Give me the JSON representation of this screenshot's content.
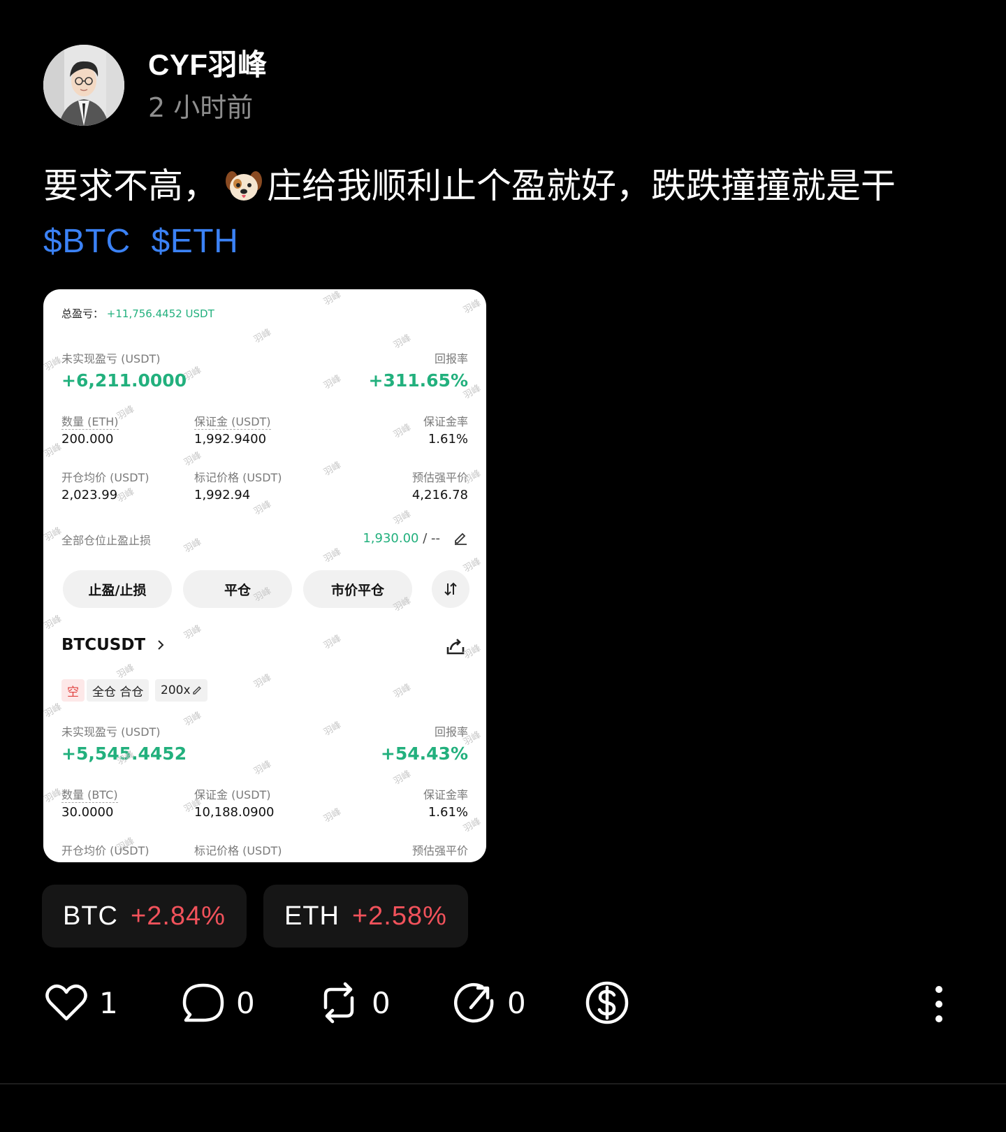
{
  "author": {
    "name": "CYF羽峰",
    "time": "2 小时前"
  },
  "post": {
    "text_before": "要求不高，",
    "emoji": "dog-face",
    "text_after": "庄给我顺利止个盈就好，跌跌撞撞就是干",
    "tags": [
      "$BTC",
      "$ETH"
    ]
  },
  "screenshot": {
    "watermark": "羽峰",
    "total_label": "总盈亏：",
    "total_value": "+11,756.4452 USDT",
    "eth": {
      "unrealized_label": "未实现盈亏 (USDT)",
      "unrealized_value": "+6,211.0000",
      "roi_label": "回报率",
      "roi_value": "+311.65%",
      "qty_label": "数量 (ETH)",
      "qty_value": "200.000",
      "margin_label": "保证金 (USDT)",
      "margin_value": "1,992.9400",
      "margin_rate_label": "保证金率",
      "margin_rate_value": "1.61%",
      "entry_label": "开仓均价 (USDT)",
      "entry_value": "2,023.99",
      "mark_label": "标记价格 (USDT)",
      "mark_value": "1,992.94",
      "liq_label": "预估强平价",
      "liq_value": "4,216.78",
      "tpsl_label": "全部仓位止盈止损",
      "tpsl_tp": "1,930.00",
      "tpsl_sep": " / ",
      "tpsl_sl": "--"
    },
    "buttons": {
      "tpsl": "止盈/止损",
      "close": "平仓",
      "market_close": "市价平仓"
    },
    "btc": {
      "pair": "BTCUSDT",
      "side": "空",
      "mode": "全仓 合仓",
      "leverage": "200x",
      "unrealized_label": "未实现盈亏 (USDT)",
      "unrealized_value": "+5,545.4452",
      "roi_label": "回报率",
      "roi_value": "+54.43%",
      "qty_label": "数量 (BTC)",
      "qty_value": "30.0000",
      "margin_label": "保证金 (USDT)",
      "margin_value": "10,188.0900",
      "margin_rate_label": "保证金率",
      "margin_rate_value": "1.61%",
      "entry_label": "开仓均价 (USDT)",
      "mark_label": "标记价格 (USDT)",
      "liq_label": "预估强平价"
    }
  },
  "tickers": [
    {
      "symbol": "BTC",
      "change": "+2.84%"
    },
    {
      "symbol": "ETH",
      "change": "+2.58%"
    }
  ],
  "actions": {
    "likes": "1",
    "comments": "0",
    "reposts": "0",
    "shares": "0"
  },
  "colors": {
    "green": "#22b07d",
    "red": "#f1525b",
    "link": "#3b82f6"
  }
}
